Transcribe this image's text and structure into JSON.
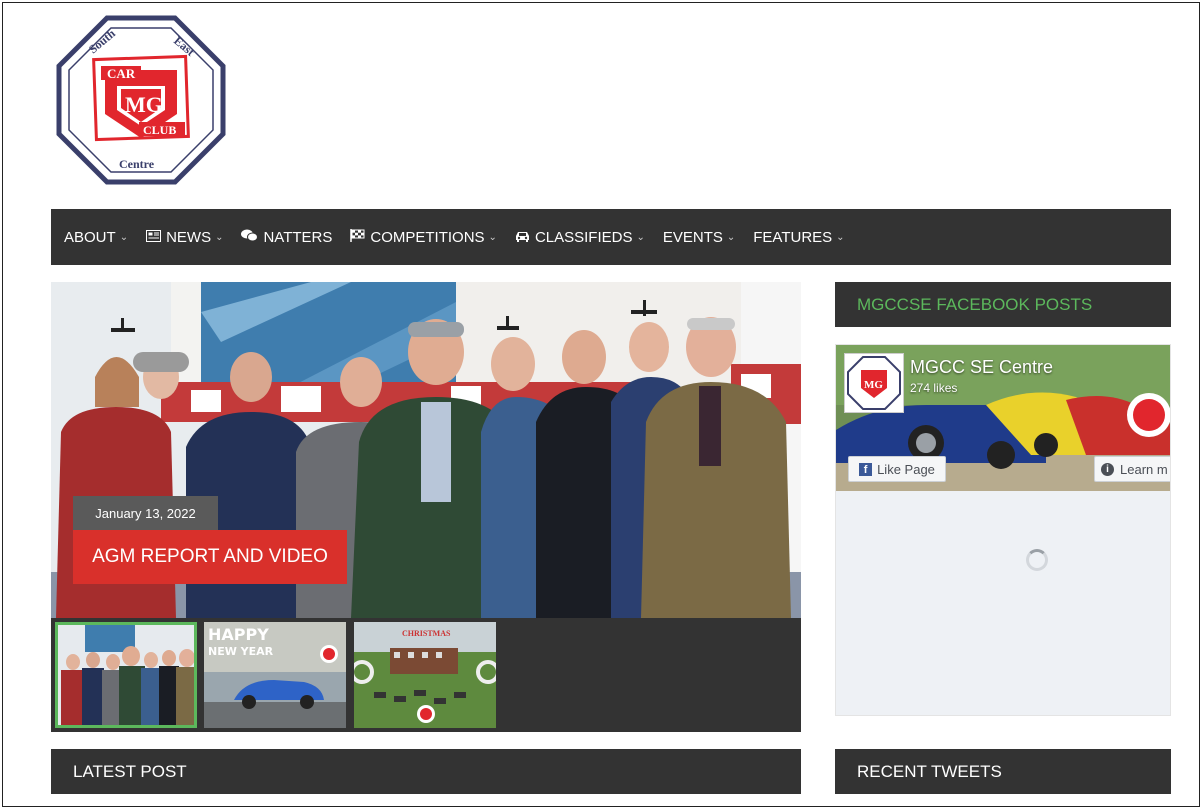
{
  "logo": {
    "text_top_left": "South",
    "text_top_right": "East",
    "text_car": "CAR",
    "text_mg": "MG",
    "text_club": "CLUB",
    "text_bottom": "Centre"
  },
  "nav": {
    "items": [
      {
        "label": "ABOUT",
        "icon": "none",
        "dropdown": true
      },
      {
        "label": "NEWS",
        "icon": "newspaper-icon",
        "dropdown": true
      },
      {
        "label": "NATTERS",
        "icon": "comments-icon",
        "dropdown": false
      },
      {
        "label": "COMPETITIONS",
        "icon": "flag-checkered-icon",
        "dropdown": true
      },
      {
        "label": "CLASSIFIEDS",
        "icon": "car-icon",
        "dropdown": true
      },
      {
        "label": "EVENTS",
        "icon": "none",
        "dropdown": true
      },
      {
        "label": "FEATURES",
        "icon": "none",
        "dropdown": true
      }
    ]
  },
  "slider": {
    "date": "January 13, 2022",
    "title": "AGM REPORT AND VIDEO",
    "thumb2_text_1": "HAPPY",
    "thumb2_text_2": "NEW YEAR",
    "thumb3_text": "CHRISTMAS"
  },
  "sidebar": {
    "facebook_heading": "MGCCSE FACEBOOK POSTS",
    "fb_page_name": "MGCC SE Centre",
    "fb_likes": "274 likes",
    "fb_like_button": "Like Page",
    "fb_learn_button": "Learn m",
    "tweets_heading": "RECENT TWEETS"
  },
  "main": {
    "latest_heading": "LATEST POST"
  },
  "colors": {
    "nav_bg": "#333333",
    "accent_red": "#d9302b",
    "heading_green": "#5cb85c",
    "logo_red": "#e1262d",
    "logo_navy": "#3a3f6b"
  }
}
